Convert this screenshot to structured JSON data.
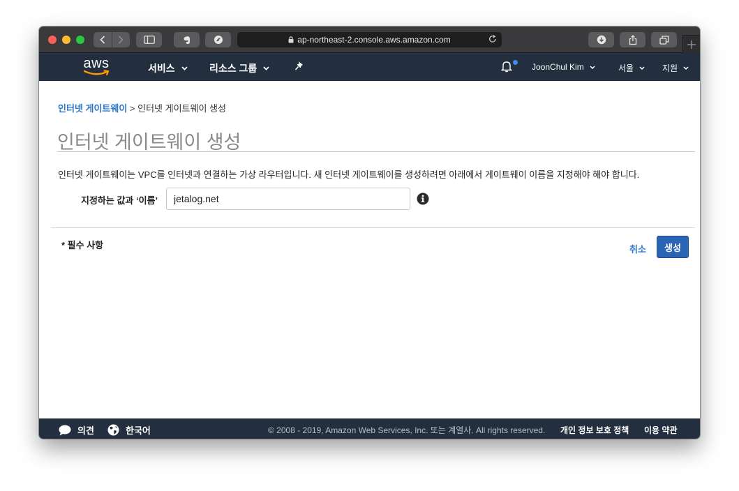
{
  "browser": {
    "url": "ap-northeast-2.console.aws.amazon.com"
  },
  "aws_nav": {
    "logo_text": "aws",
    "services_label": "서비스",
    "resource_groups_label": "리소스 그룹",
    "user_name": "JoonChul Kim",
    "region_label": "서울",
    "support_label": "지원"
  },
  "breadcrumb": {
    "parent": "인터넷 게이트웨이",
    "separator": ">",
    "current": "인터넷 게이트웨이 생성"
  },
  "page": {
    "title": "인터넷 게이트웨이 생성",
    "description": "인터넷 게이트웨이는 VPC를 인터넷과 연결하는 가상 라우터입니다. 새 인터넷 게이트웨이를 생성하려면 아래에서 게이트웨이 이름을 지정해야 해야 합니다.",
    "name_label": "지정하는 값과 ‘이름’",
    "name_value": "jetalog.net",
    "required_note": "* 필수 사항",
    "cancel_label": "취소",
    "create_label": "생성"
  },
  "footer": {
    "feedback_label": "의견",
    "language_label": "한국어",
    "copyright": "© 2008 - 2019, Amazon Web Services, Inc. 또는 계열사. All rights reserved.",
    "privacy_label": "개인 정보 보호 정책",
    "terms_label": "이용 약관"
  },
  "colors": {
    "nav_bg": "#232f3e",
    "link": "#2d75c8",
    "primary_button": "#2a64b5",
    "aws_smile": "#ff9900",
    "notification_dot": "#3d8ef0"
  },
  "icons": {
    "back": "chevron-left-icon",
    "forward": "chevron-right-icon",
    "sidebar": "sidebar-icon",
    "evernote": "evernote-icon",
    "extension": "extension-icon",
    "lock": "lock-icon",
    "reload": "reload-icon",
    "download": "download-icon",
    "share": "share-icon",
    "tabs": "tabs-icon",
    "pin": "pin-icon",
    "bell": "bell-icon",
    "info": "info-icon",
    "feedback": "speech-bubble-icon",
    "globe": "globe-icon"
  }
}
